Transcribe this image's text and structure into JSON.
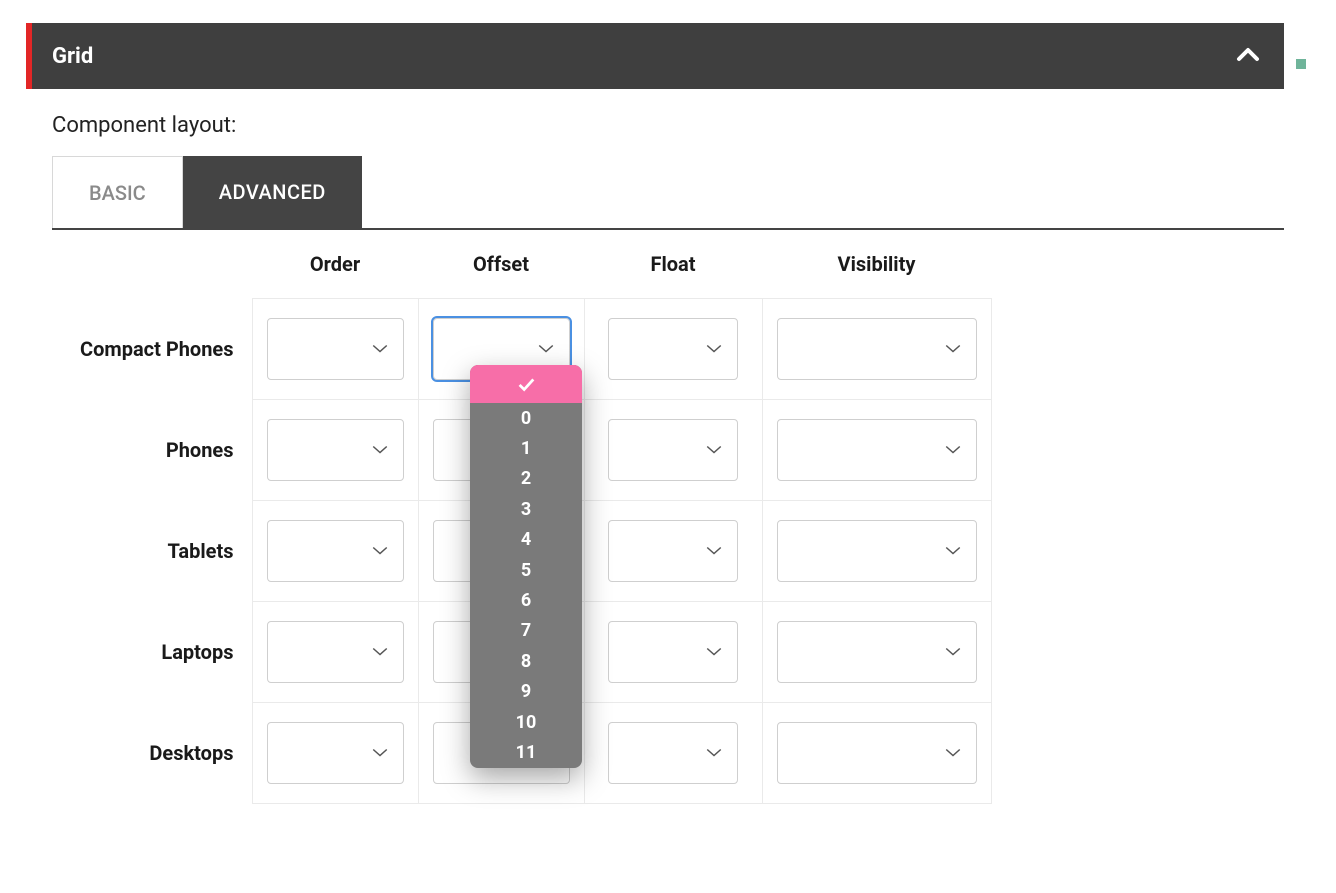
{
  "header": {
    "title": "Grid"
  },
  "section": {
    "label": "Component layout:"
  },
  "tabs": {
    "basic": "BASIC",
    "advanced": "ADVANCED",
    "active": "advanced"
  },
  "columns": [
    "Order",
    "Offset",
    "Float",
    "Visibility"
  ],
  "rows": [
    "Compact Phones",
    "Phones",
    "Tablets",
    "Laptops",
    "Desktops"
  ],
  "cells": {
    "compact_phones": {
      "order": "",
      "offset": "",
      "float": "",
      "visibility": ""
    },
    "phones": {
      "order": "",
      "offset": "",
      "float": "",
      "visibility": ""
    },
    "tablets": {
      "order": "",
      "offset": "",
      "float": "",
      "visibility": ""
    },
    "laptops": {
      "order": "",
      "offset": "",
      "float": "",
      "visibility": ""
    },
    "desktops": {
      "order": "",
      "offset": "",
      "float": "",
      "visibility": ""
    }
  },
  "dropdown": {
    "open_for": "compact_phones.offset",
    "selected": "",
    "options": [
      "",
      "0",
      "1",
      "2",
      "3",
      "4",
      "5",
      "6",
      "7",
      "8",
      "9",
      "10",
      "11"
    ]
  }
}
